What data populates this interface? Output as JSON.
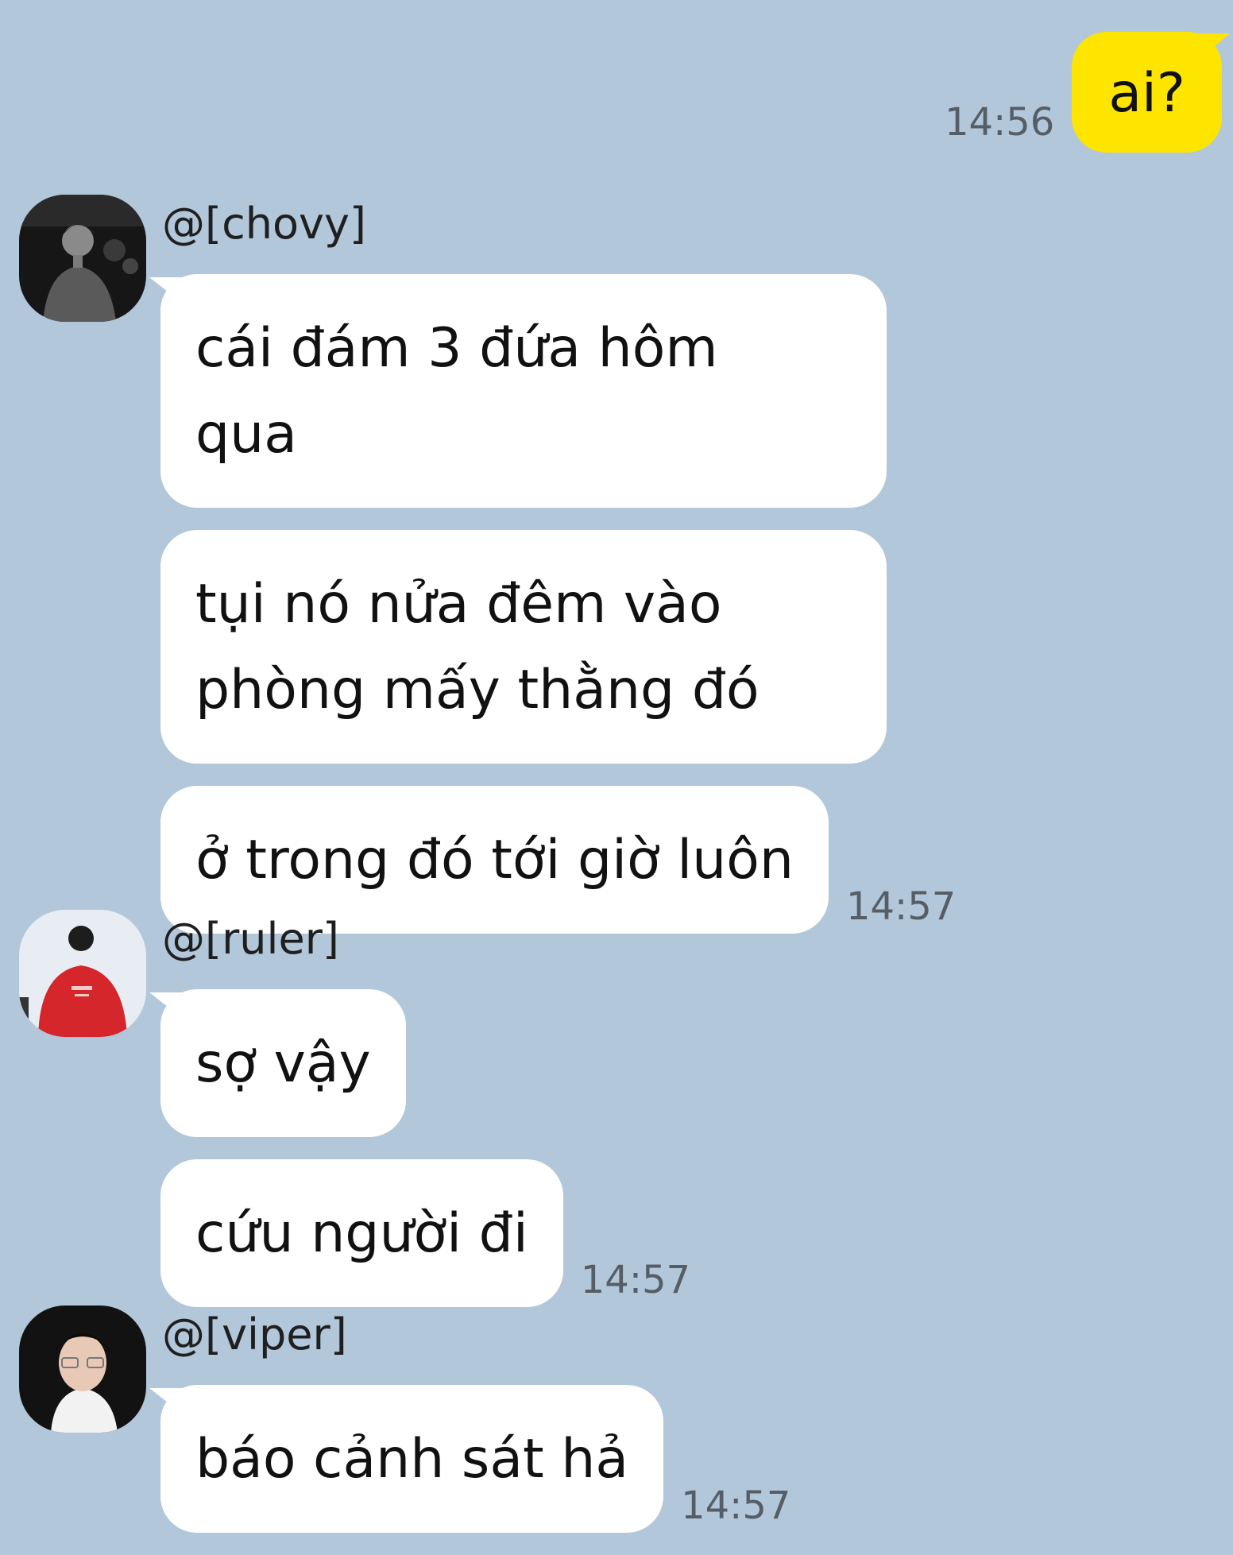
{
  "outgoing": {
    "text": "ai?",
    "time": "14:56"
  },
  "groups": [
    {
      "sender": "@[chovy]",
      "avatar_icon": "profile-photo-dark",
      "messages": [
        {
          "lines": [
            "cái đám 3 đứa hôm",
            "qua"
          ],
          "time": ""
        },
        {
          "lines": [
            "tụi nó nửa đêm vào",
            "phòng mấy thằng đó"
          ],
          "time": ""
        },
        {
          "lines": [
            "ở trong đó tới giờ luôn"
          ],
          "time": "14:57"
        }
      ]
    },
    {
      "sender": "@[ruler]",
      "avatar_icon": "profile-photo-red-jersey",
      "messages": [
        {
          "lines": [
            "sợ vậy"
          ],
          "time": ""
        },
        {
          "lines": [
            "cứu người đi"
          ],
          "time": "14:57"
        }
      ]
    },
    {
      "sender": "@[viper]",
      "avatar_icon": "profile-photo-glasses",
      "messages": [
        {
          "lines": [
            "báo cảnh sát hả"
          ],
          "time": "14:57"
        }
      ]
    }
  ],
  "colors": {
    "background": "#b2c7da",
    "outgoing_bubble": "#fee500",
    "incoming_bubble": "#ffffff"
  }
}
